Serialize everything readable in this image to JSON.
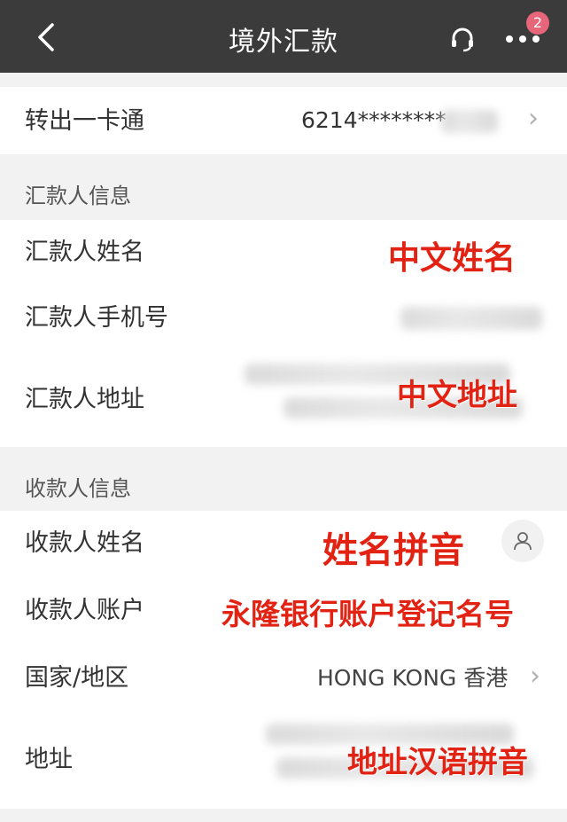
{
  "header": {
    "title": "境外汇款",
    "notification_count": "2"
  },
  "card": {
    "label": "转出一卡通",
    "number": "6214********"
  },
  "remitter": {
    "section_title": "汇款人信息",
    "name_label": "汇款人姓名",
    "phone_label": "汇款人手机号",
    "address_label": "汇款人地址"
  },
  "payee": {
    "section_title": "收款人信息",
    "name_label": "收款人姓名",
    "account_label": "收款人账户",
    "country_label": "国家/地区",
    "country_value": "HONG KONG 香港",
    "address_label": "地址"
  },
  "annotations": {
    "chinese_name": "中文姓名",
    "chinese_address": "中文地址",
    "name_pinyin": "姓名拼音",
    "account_note": "永隆银行账户登记名号",
    "address_pinyin": "地址汉语拼音"
  },
  "colors": {
    "header_bg": "#3b3b3b",
    "annotation_red": "#e22213",
    "badge": "#e8667a"
  },
  "icons": {
    "back": "chevron-left-icon",
    "service": "headset-icon",
    "more": "more-dots-icon",
    "contact": "person-icon"
  }
}
